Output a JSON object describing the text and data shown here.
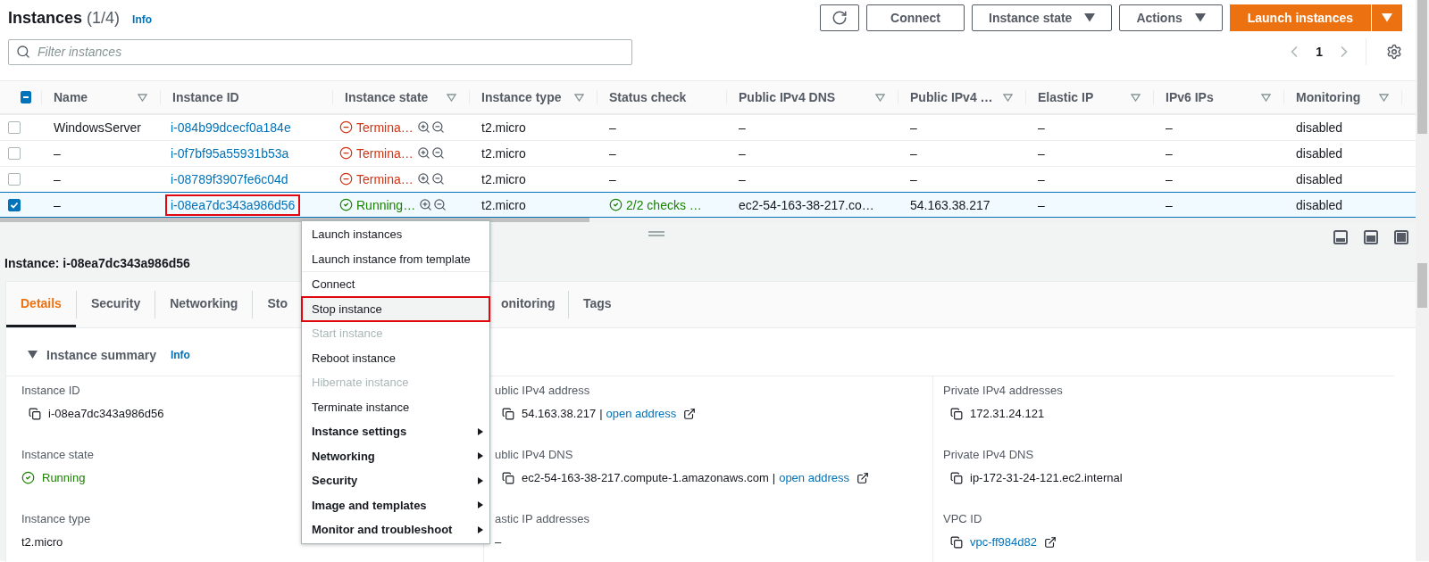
{
  "header": {
    "title": "Instances",
    "count": "(1/4)",
    "info": "Info"
  },
  "toolbar": {
    "buttons": [
      {
        "kind": "refresh"
      },
      {
        "kind": "plain",
        "label": "Connect"
      },
      {
        "kind": "dropdown",
        "label": "Instance state"
      },
      {
        "kind": "dropdown",
        "label": "Actions"
      },
      {
        "kind": "primary-split",
        "label": "Launch instances"
      }
    ]
  },
  "filter": {
    "placeholder": "Filter instances"
  },
  "pagination": {
    "page": "1"
  },
  "table": {
    "header_checkbox": {
      "indeterminate": true
    },
    "columns": [
      {
        "label": "Name",
        "filter": true
      },
      {
        "label": "Instance ID",
        "filter": false
      },
      {
        "label": "Instance state",
        "filter": true
      },
      {
        "label": "Instance type",
        "filter": true
      },
      {
        "label": "Status check",
        "filter": false
      },
      {
        "label": "Public IPv4 DNS",
        "filter": true
      },
      {
        "label": "Public IPv4 …",
        "filter": true
      },
      {
        "label": "Elastic IP",
        "filter": true
      },
      {
        "label": "IPv6 IPs",
        "filter": true
      },
      {
        "label": "Monitoring",
        "filter": true
      }
    ],
    "rows": [
      {
        "selected": false,
        "name": "WindowsServer",
        "instance_id": "i-084b99dcecf0a184e",
        "highlighted": false,
        "state": {
          "kind": "terminated",
          "label": "Termina…"
        },
        "type": "t2.micro",
        "status_check": {
          "kind": "none",
          "label": "–"
        },
        "dns": "–",
        "ipv4": "–",
        "elastic_ip": "–",
        "ipv6": "–",
        "monitoring": "disabled"
      },
      {
        "selected": false,
        "name": "–",
        "instance_id": "i-0f7bf95a55931b53a",
        "highlighted": false,
        "state": {
          "kind": "terminated",
          "label": "Termina…"
        },
        "type": "t2.micro",
        "status_check": {
          "kind": "none",
          "label": "–"
        },
        "dns": "–",
        "ipv4": "–",
        "elastic_ip": "–",
        "ipv6": "–",
        "monitoring": "disabled"
      },
      {
        "selected": false,
        "name": "–",
        "instance_id": "i-08789f3907fe6c04d",
        "highlighted": false,
        "state": {
          "kind": "terminated",
          "label": "Termina…"
        },
        "type": "t2.micro",
        "status_check": {
          "kind": "none",
          "label": "–"
        },
        "dns": "–",
        "ipv4": "–",
        "elastic_ip": "–",
        "ipv6": "–",
        "monitoring": "disabled"
      },
      {
        "selected": true,
        "name": "–",
        "instance_id": "i-08ea7dc343a986d56",
        "highlighted": true,
        "state": {
          "kind": "running",
          "label": "Running…"
        },
        "type": "t2.micro",
        "status_check": {
          "kind": "ok",
          "label": "2/2 checks …"
        },
        "dns": "ec2-54-163-38-217.co…",
        "ipv4": "54.163.38.217",
        "elastic_ip": "–",
        "ipv6": "–",
        "monitoring": "disabled"
      }
    ]
  },
  "context_menu": {
    "groups": [
      [
        {
          "label": "Launch instances",
          "kind": "action",
          "disabled": false,
          "hovered": false,
          "highlighted": false
        },
        {
          "label": "Launch instance from template",
          "kind": "action",
          "disabled": false,
          "hovered": false,
          "highlighted": false
        }
      ],
      [
        {
          "label": "Connect",
          "kind": "action",
          "disabled": false,
          "hovered": false,
          "highlighted": false
        },
        {
          "label": "Stop instance",
          "kind": "action",
          "disabled": false,
          "hovered": true,
          "highlighted": true
        },
        {
          "label": "Start instance",
          "kind": "action",
          "disabled": true,
          "hovered": false,
          "highlighted": false
        },
        {
          "label": "Reboot instance",
          "kind": "action",
          "disabled": false,
          "hovered": false,
          "highlighted": false
        },
        {
          "label": "Hibernate instance",
          "kind": "action",
          "disabled": true,
          "hovered": false,
          "highlighted": false
        },
        {
          "label": "Terminate instance",
          "kind": "action",
          "disabled": false,
          "hovered": false,
          "highlighted": false
        },
        {
          "label": "Instance settings",
          "kind": "submenu",
          "disabled": false,
          "hovered": false,
          "highlighted": false
        },
        {
          "label": "Networking",
          "kind": "submenu",
          "disabled": false,
          "hovered": false,
          "highlighted": false
        },
        {
          "label": "Security",
          "kind": "submenu",
          "disabled": false,
          "hovered": false,
          "highlighted": false
        },
        {
          "label": "Image and templates",
          "kind": "submenu",
          "disabled": false,
          "hovered": false,
          "highlighted": false
        },
        {
          "label": "Monitor and troubleshoot",
          "kind": "submenu",
          "disabled": false,
          "hovered": false,
          "highlighted": false
        }
      ]
    ]
  },
  "details": {
    "title": "Instance: i-08ea7dc343a986d56",
    "tabs": [
      {
        "label": "Details",
        "selected": true
      },
      {
        "label": "Security",
        "selected": false
      },
      {
        "label": "Networking",
        "selected": false
      },
      {
        "label": "Sto",
        "selected": false
      },
      {
        "label": "onitoring",
        "selected": false
      },
      {
        "label": "Tags",
        "selected": false
      }
    ],
    "section": {
      "title": "Instance summary",
      "expanded": true,
      "info": "Info"
    },
    "columns": [
      [
        {
          "kind": "copy",
          "label": "Instance ID",
          "value": "i-08ea7dc343a986d56"
        },
        {
          "kind": "status",
          "label": "Instance state",
          "value": "Running"
        },
        {
          "kind": "plain",
          "label": "Instance type",
          "value": "t2.micro"
        }
      ],
      [
        {
          "kind": "copy",
          "label": "ublic IPv4 address",
          "value": "54.163.38.217",
          "separator": "|",
          "link": "open address"
        },
        {
          "kind": "copy",
          "label": "ublic IPv4 DNS",
          "value": "ec2-54-163-38-217.compute-1.amazonaws.com",
          "separator": "|",
          "link": "open address"
        },
        {
          "kind": "plain",
          "label": "astic IP addresses",
          "value": "–"
        }
      ],
      [
        {
          "kind": "copy",
          "label": "Private IPv4 addresses",
          "value": "172.31.24.121"
        },
        {
          "kind": "copy",
          "label": "Private IPv4 DNS",
          "value": "ip-172-31-24-121.ec2.internal"
        },
        {
          "kind": "copy",
          "label": "VPC ID",
          "link": "vpc-ff984d82"
        }
      ]
    ]
  }
}
